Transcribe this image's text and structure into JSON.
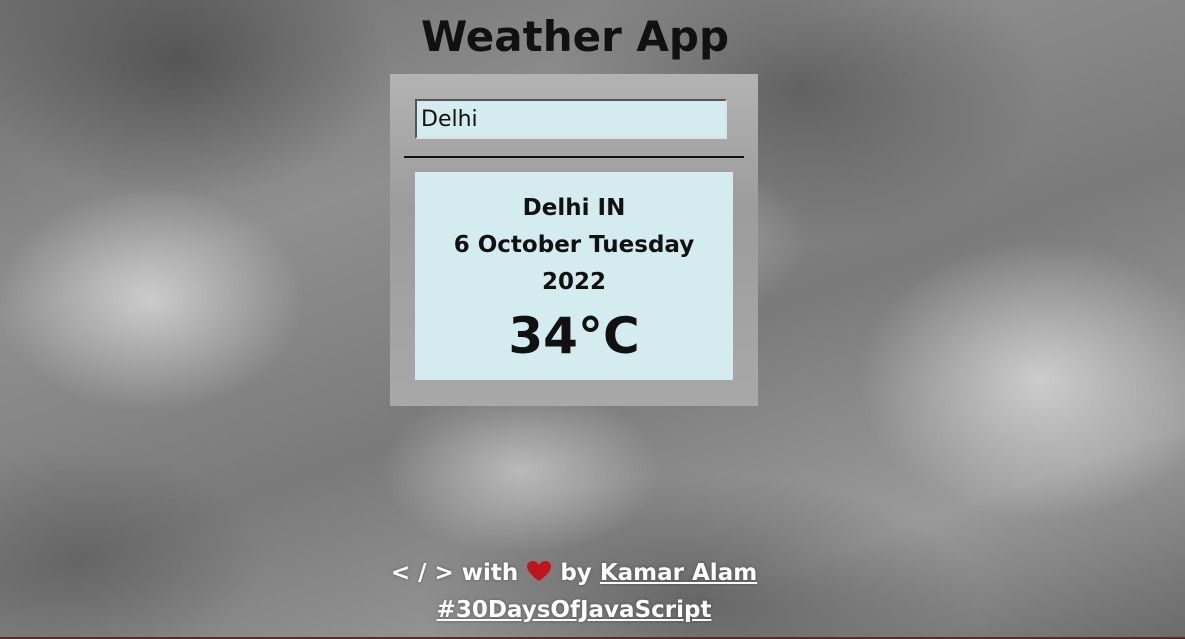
{
  "app": {
    "title": "Weather App"
  },
  "search": {
    "value": "Delhi"
  },
  "weather": {
    "location": "Delhi IN",
    "date": "6 October Tuesday",
    "year": "2022",
    "temperature": "34°C"
  },
  "footer": {
    "code_symbol": "< / >",
    "with_text": "with",
    "heart_icon": "heart-icon",
    "by_text": "by",
    "author": "Kamar Alam",
    "hashtag": "#30DaysOfJavaScript"
  },
  "colors": {
    "panel": "#d4ebf0",
    "heart": "#c0161b"
  }
}
